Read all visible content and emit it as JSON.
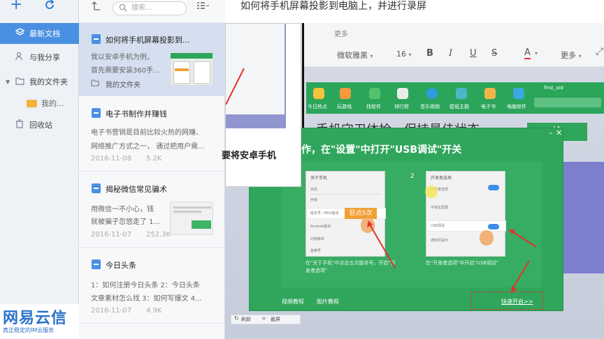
{
  "sidebar": {
    "items": [
      {
        "label": "最新文档",
        "icon": "layers-icon"
      },
      {
        "label": "与我分享",
        "icon": "share-user-icon"
      },
      {
        "label": "我的文件夹",
        "icon": "folder-outline-icon"
      },
      {
        "label": "我的...",
        "icon": "folder-icon"
      },
      {
        "label": "回收站",
        "icon": "trash-icon"
      }
    ]
  },
  "notelist": {
    "search_placeholder": "搜索...",
    "notes": [
      {
        "title": "如何将手机屏幕投影到...",
        "snippet1": "我以安卓手机为例，",
        "snippet2": "首先需要安装360手...",
        "folder": "我的文件夹"
      },
      {
        "title": "电子书制作并赚钱",
        "snippet1": "电子书营销是目前比较火热的网赚、",
        "snippet2": "网络推广方式之一， 通过把用户需...",
        "date": "2016-11-08",
        "size": "5.2K"
      },
      {
        "title": "揭秘微信常见骗术",
        "snippet1": "用微信一不小心，钱",
        "snippet2": "就被骗子忽悠走了 1...",
        "date": "2016-11-07",
        "size": "252.3K"
      },
      {
        "title": "今日头条",
        "snippet1": "1：如何注册今日头条 2：今日头条",
        "snippet2": "文章素材怎么找 3：如何写爆文 4...",
        "date": "2016-11-07",
        "size": "4.9K"
      }
    ]
  },
  "main": {
    "doc_title": "如何将手机屏幕投影到电脑上，并进行录屏",
    "more_top": "更多",
    "font_name": "微软雅黑",
    "font_size": "16",
    "bold": "B",
    "italic": "I",
    "underline": "U",
    "strike": "S",
    "color_a": "A",
    "more": "更多",
    "popup_text": "要将安卓手机",
    "green_corner": "first_aid",
    "apps": [
      "今日热点",
      "玩游戏",
      "找软件",
      "排行榜",
      "音乐视频",
      "壁纸主题",
      "电子书",
      "电脑软件"
    ],
    "behind_heading": "手机守卫体检，保持最佳状态",
    "check_btn": "检",
    "dialog": {
      "instruction": "在手机上操作，在\"设置\"中打开\"USB调试\"开关",
      "step2": "2",
      "phone1_title": "关于手机",
      "phone1_rows": [
        "状态",
        "存储",
        "版本号 / MIUI版本",
        "Android版本",
        "内核版本",
        "基带号"
      ],
      "tap_label": "狂点5次",
      "phone2_title": "开发者选项",
      "phone2_rows": [
        "开发者选项",
        "不锁定屏幕",
        "USB调试",
        "通知栏提示"
      ],
      "caption1": "在\"关于手机\"中点击五次版本号，开启\"开发者选项\"",
      "caption2": "在\"开发者选项\"中开启\"USB调试\"",
      "video_tut": "视频教程",
      "image_tut": "图片教程",
      "quick_open": "快速开启>>"
    },
    "bottom_refresh": "刷新",
    "bottom_screenshot": "截屏"
  },
  "watermark": {
    "brand": "网易云信",
    "slogan": "真正稳定的IM云服务"
  },
  "colors": {
    "accent": "#4a90e2",
    "green": "#2fa65b",
    "arrow_red": "#e0332b",
    "orange": "#f0a035"
  }
}
